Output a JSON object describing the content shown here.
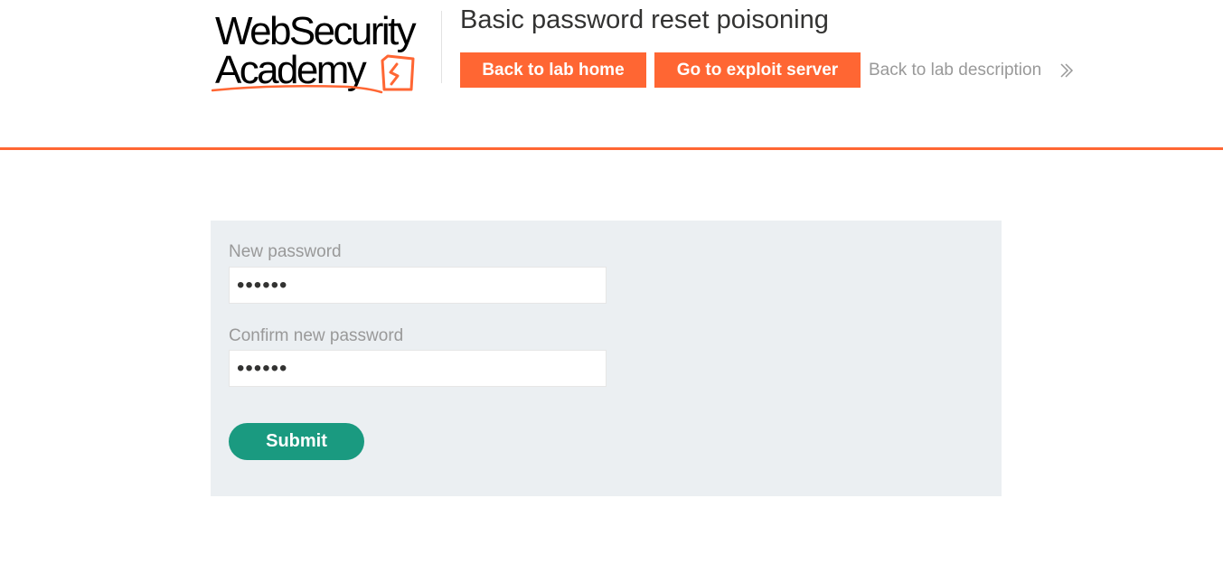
{
  "logo": {
    "line1": "WebSecurity",
    "line2": "Academy",
    "colors": {
      "text": "#000000",
      "accent": "#ff6633"
    }
  },
  "header": {
    "lab_title": "Basic password reset poisoning",
    "buttons": {
      "lab_home": "Back to lab home",
      "exploit_server": "Go to exploit server"
    },
    "back_to_description": "Back to lab description",
    "back_icon": "double-chevron-right-icon",
    "accent_color": "#ff6633"
  },
  "form": {
    "new_password": {
      "label": "New password",
      "value_masked": "••••••"
    },
    "confirm_password": {
      "label": "Confirm new password",
      "value_masked": "••••••"
    },
    "submit_label": "Submit",
    "panel_color": "#ebeff2",
    "submit_color": "#1a9a80"
  }
}
